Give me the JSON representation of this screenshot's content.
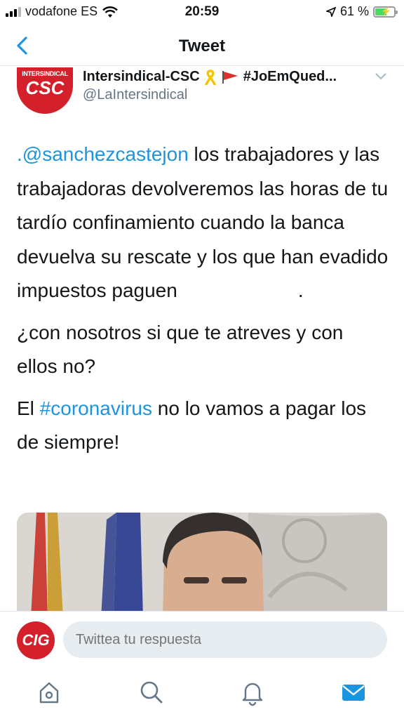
{
  "status_bar": {
    "carrier": "vodafone ES",
    "time": "20:59",
    "battery_text": "61 %",
    "battery_level": 0.61,
    "icons": [
      "signal-icon",
      "wifi-icon",
      "location-arrow-icon",
      "battery-charging-icon"
    ]
  },
  "nav": {
    "title": "Tweet",
    "back_icon": "chevron-left-icon"
  },
  "tweet": {
    "author_name": "Intersindical-CSC",
    "author_hashtag": "#JoEmQued...",
    "handle": "@LaIntersindical",
    "avatar_brand_small": "INTERSINDICAL",
    "avatar_brand_big": "CSC",
    "mention": ".@sanchezcastejon",
    "text1_rest": " los trabajadores y las trabajadoras devolveremos las horas de tu tardío confinamiento cuando la banca devuelva su rescate y los que han evadido impuestos paguen",
    "text1_dot": ".",
    "text2": "¿con nosotros si que te atreves y con ellos no?",
    "text3_before": "El ",
    "hashtag": "#coronavirus",
    "text3_after": " no lo vamos a pagar los de siempre!"
  },
  "reply": {
    "avatar_text": "CIG",
    "placeholder": "Twittea tu respuesta"
  },
  "tabs": [
    {
      "name": "home-icon"
    },
    {
      "name": "search-icon"
    },
    {
      "name": "notifications-bell-icon"
    },
    {
      "name": "messages-envelope-icon"
    }
  ],
  "colors": {
    "accent": "#1b95e0",
    "brand_red": "#d4202b",
    "muted": "#657786"
  }
}
